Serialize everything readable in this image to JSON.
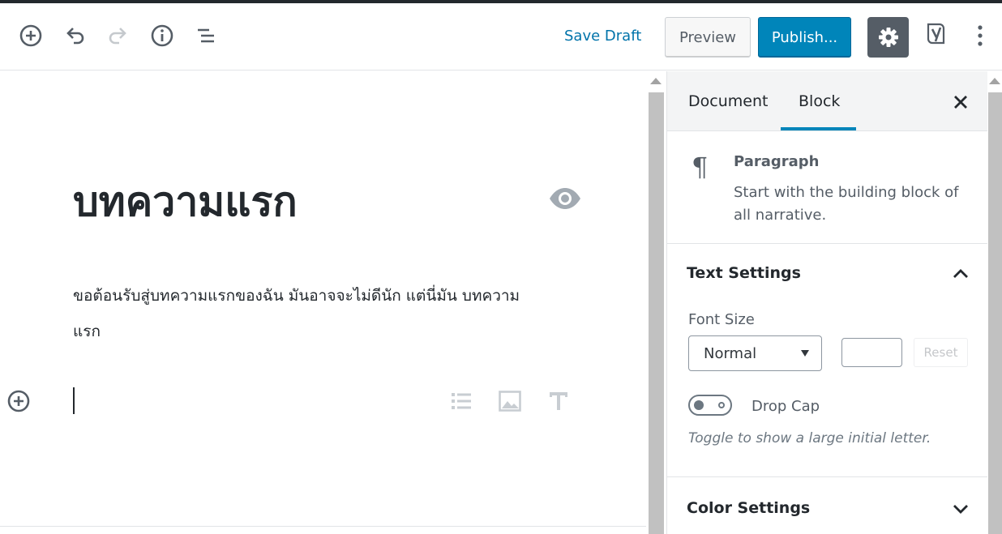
{
  "toolbar": {
    "add_block_label": "Add block",
    "undo_label": "Undo",
    "redo_label": "Redo",
    "info_label": "Content structure",
    "outline_label": "Block navigation",
    "save_draft": "Save Draft",
    "preview": "Preview",
    "publish": "Publish...",
    "settings_label": "Settings",
    "yoast_label": "Yoast SEO",
    "more_label": "More tools & options"
  },
  "editor": {
    "title": "บทความแรก",
    "paragraph": "ขอต้อนรับสู่บทความแรกของฉัน มันอาจจะไม่ดีนัก แต่นี่มัน บทความแรก",
    "quick_inserters": [
      "list-icon",
      "image-icon",
      "heading-icon"
    ]
  },
  "sidebar": {
    "tabs": [
      {
        "label": "Document",
        "active": false
      },
      {
        "label": "Block",
        "active": true
      }
    ],
    "block_card": {
      "title": "Paragraph",
      "description": "Start with the building block of all narrative."
    },
    "text_settings": {
      "header": "Text Settings",
      "expanded": true,
      "font_size_label": "Font Size",
      "font_size_value": "Normal",
      "custom_size_value": "",
      "reset_label": "Reset",
      "drop_cap_label": "Drop Cap",
      "drop_cap_enabled": false,
      "drop_cap_help": "Toggle to show a large initial letter."
    },
    "color_settings": {
      "header": "Color Settings",
      "expanded": false
    }
  },
  "colors": {
    "accent": "#0085ba",
    "link": "#0073aa",
    "text": "#23282d",
    "muted": "#555d66"
  }
}
